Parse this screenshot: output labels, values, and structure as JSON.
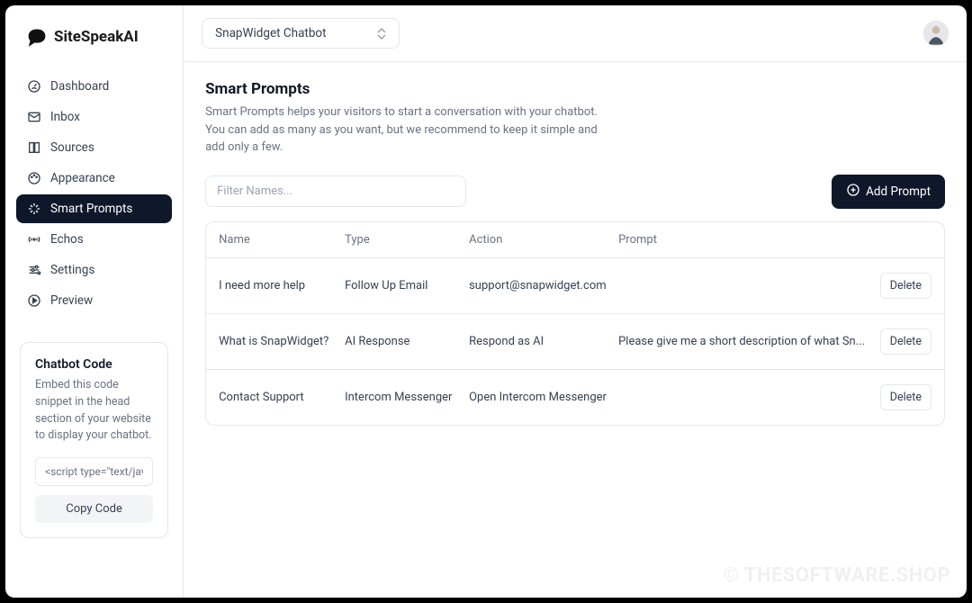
{
  "brand": "SiteSpeakAI",
  "selected_chatbot": "SnapWidget Chatbot",
  "sidebar": {
    "items": [
      {
        "label": "Dashboard",
        "icon": "gauge"
      },
      {
        "label": "Inbox",
        "icon": "mail"
      },
      {
        "label": "Sources",
        "icon": "book"
      },
      {
        "label": "Appearance",
        "icon": "palette"
      },
      {
        "label": "Smart Prompts",
        "icon": "sparkle"
      },
      {
        "label": "Echos",
        "icon": "broadcast"
      },
      {
        "label": "Settings",
        "icon": "sliders"
      },
      {
        "label": "Preview",
        "icon": "play"
      }
    ],
    "active_index": 4
  },
  "chatbot_code": {
    "title": "Chatbot Code",
    "description": "Embed this code snippet in the head section of your website to display your chatbot.",
    "snippet": "<script type=\"text/javascript\"",
    "copy_label": "Copy Code"
  },
  "page": {
    "title": "Smart Prompts",
    "subtitle": "Smart Prompts helps your visitors to start a conversation with your chatbot. You can add as many as you want, but we recommend to keep it simple and add only a few.",
    "filter_placeholder": "Filter Names...",
    "add_label": "Add Prompt"
  },
  "table": {
    "headers": {
      "name": "Name",
      "type": "Type",
      "action": "Action",
      "prompt": "Prompt"
    },
    "delete_label": "Delete",
    "rows": [
      {
        "name": "I need more help",
        "type": "Follow Up Email",
        "action": "support@snapwidget.com",
        "prompt": ""
      },
      {
        "name": "What is SnapWidget?",
        "type": "AI Response",
        "action": "Respond as AI",
        "prompt": "Please give me a short description of what Sn..."
      },
      {
        "name": "Contact Support",
        "type": "Intercom Messenger",
        "action": "Open Intercom Messenger",
        "prompt": ""
      }
    ]
  },
  "watermark": "© THESOFTWARE.SHOP"
}
